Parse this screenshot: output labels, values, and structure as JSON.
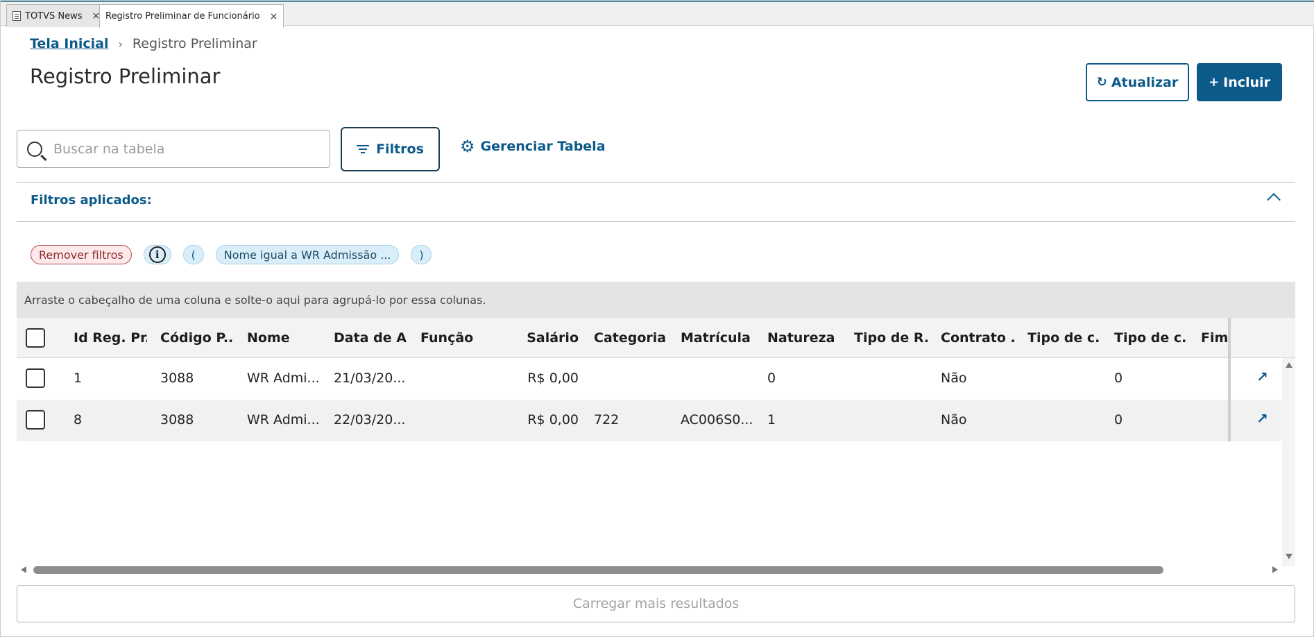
{
  "tabs": [
    {
      "label": "TOTVS News",
      "close": "×",
      "active": false
    },
    {
      "label": "Registro Preliminar de Funcionário",
      "close": "×",
      "active": true
    }
  ],
  "breadcrumb": {
    "home": "Tela Inicial",
    "separator": "›",
    "current": "Registro Preliminar"
  },
  "page_title": "Registro Preliminar",
  "actions": {
    "refresh_label": "Atualizar",
    "refresh_icon": "↻",
    "add_label": "Incluir",
    "add_icon": "+"
  },
  "toolbar": {
    "search_placeholder": "Buscar na tabela",
    "filters_label": "Filtros",
    "manage_label": "Gerenciar Tabela",
    "manage_icon": "⚙"
  },
  "applied_filters": {
    "title": "Filtros aplicados:",
    "remove_label": "Remover filtros",
    "info_icon": "i",
    "open_paren": "(",
    "condition": "Nome igual a WR Admissão ...",
    "close_paren": ")"
  },
  "grid": {
    "group_hint": "Arraste o cabeçalho de uma coluna e solte-o aqui para agrupá-lo por essa colunas.",
    "columns": [
      "Id Reg. Pr...",
      "Código P...",
      "Nome",
      "Data de A...",
      "Função",
      "Salário",
      "Categoria...",
      "Matrícula ...",
      "Natureza ...",
      "Tipo de R...",
      "Contrato ...",
      "Tipo de c...",
      "Tipo de c...",
      "Fim c"
    ],
    "rows": [
      [
        "1",
        "3088",
        "WR Admi...",
        "21/03/20...",
        "",
        "R$ 0,00",
        "",
        "",
        "0",
        "",
        "Não",
        "",
        "0",
        ""
      ],
      [
        "8",
        "3088",
        "WR Admi...",
        "22/03/20...",
        "",
        "R$ 0,00",
        "722",
        "AC006S0...",
        "1",
        "",
        "Não",
        "",
        "0",
        ""
      ]
    ],
    "open_icon": "↗"
  },
  "load_more_label": "Carregar mais resultados",
  "colors": {
    "primary": "#0c5a8a",
    "chip_bg": "#d9eef9",
    "remove_chip_bg": "#fde9e9"
  }
}
